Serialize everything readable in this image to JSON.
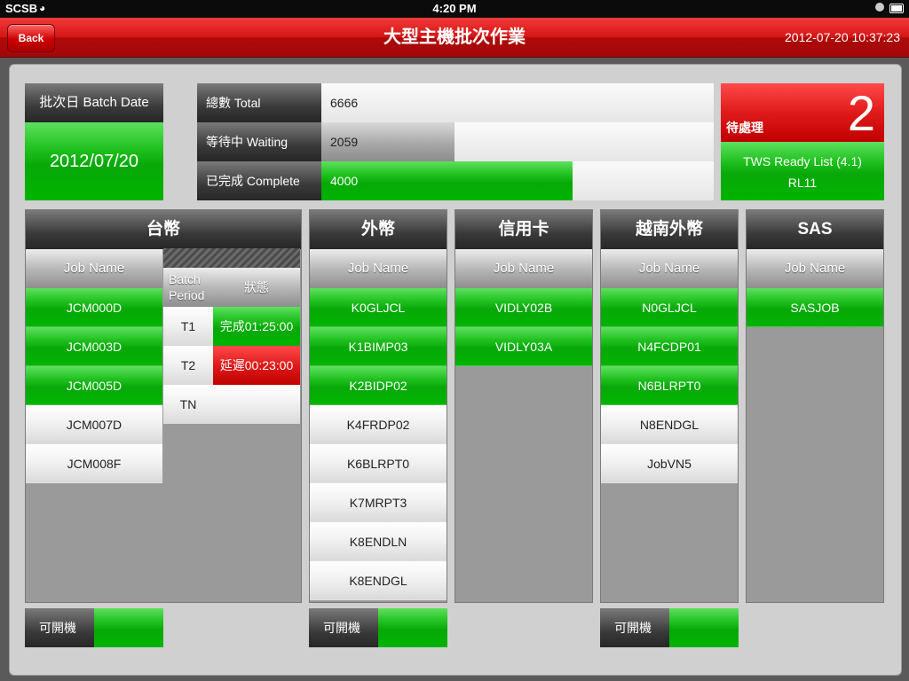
{
  "status_bar": {
    "carrier": "SCSB",
    "time": "4:20 PM"
  },
  "nav": {
    "back_label": "Back",
    "title": "大型主機批次作業",
    "datetime": "2012-07-20 10:37:23"
  },
  "batch": {
    "label": "批次日 Batch Date",
    "date": "2012/07/20"
  },
  "stats": [
    {
      "label": "總數 Total",
      "value": "6666",
      "fraction": 1.0
    },
    {
      "label": "等待中 Waiting",
      "value": "2059",
      "fraction": 0.34
    },
    {
      "label": "已完成 Complete",
      "value": "4000",
      "fraction": 0.64
    }
  ],
  "pending": {
    "label": "待處理",
    "count": "2",
    "tws_title": "TWS Ready List (4.1)",
    "tws_id": "RL11"
  },
  "job_name_header": "Job Name",
  "columns": [
    {
      "title": "台幣",
      "jobs": [
        {
          "name": "JCM000D",
          "status": "green"
        },
        {
          "name": "JCM003D",
          "status": "green"
        },
        {
          "name": "JCM005D",
          "status": "green"
        },
        {
          "name": "JCM007D",
          "status": "white"
        },
        {
          "name": "JCM008F",
          "status": "white"
        }
      ]
    },
    {
      "title": "外幣",
      "jobs": [
        {
          "name": "K0GLJCL",
          "status": "green"
        },
        {
          "name": "K1BIMP03",
          "status": "green"
        },
        {
          "name": "K2BIDP02",
          "status": "green"
        },
        {
          "name": "K4FRDP02",
          "status": "white"
        },
        {
          "name": "K6BLRPT0",
          "status": "white"
        },
        {
          "name": "K7MRPT3",
          "status": "white"
        },
        {
          "name": "K8ENDLN",
          "status": "white"
        },
        {
          "name": "K8ENDGL",
          "status": "white"
        }
      ]
    },
    {
      "title": "信用卡",
      "jobs": [
        {
          "name": "VIDLY02B",
          "status": "green"
        },
        {
          "name": "VIDLY03A",
          "status": "green"
        }
      ]
    },
    {
      "title": "越南外幣",
      "jobs": [
        {
          "name": "N0GLJCL",
          "status": "green"
        },
        {
          "name": "N4FCDP01",
          "status": "green"
        },
        {
          "name": "N6BLRPT0",
          "status": "green"
        },
        {
          "name": "N8ENDGL",
          "status": "white"
        },
        {
          "name": "JobVN5",
          "status": "white"
        }
      ]
    },
    {
      "title": "SAS",
      "jobs": [
        {
          "name": "SASJOB",
          "status": "green"
        }
      ]
    }
  ],
  "period": {
    "head_period": "Batch Period",
    "head_status": "狀態",
    "rows": [
      {
        "key": "T1",
        "value": "完成01:25:00",
        "status": "green"
      },
      {
        "key": "T2",
        "value": "延遲00:23:00",
        "status": "red"
      },
      {
        "key": "TN",
        "value": "",
        "status": "white"
      }
    ]
  },
  "toggle_label": "可開機"
}
